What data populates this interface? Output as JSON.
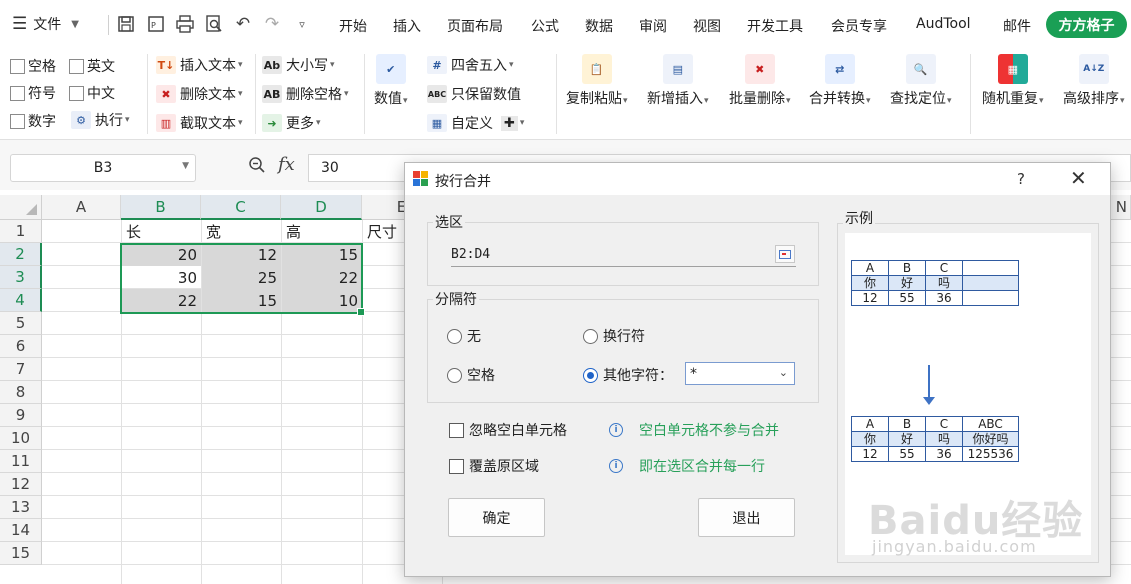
{
  "menubar": {
    "file_label": "文件",
    "tabs": [
      "开始",
      "插入",
      "页面布局",
      "公式",
      "数据",
      "审阅",
      "视图",
      "开发工具",
      "会员专享",
      "AudTool",
      "邮件"
    ],
    "active_tab": "方方格子"
  },
  "ribbon": {
    "checkboxes": [
      "空格",
      "英文",
      "符号",
      "中文",
      "数字"
    ],
    "execute": "执行",
    "text_tools": [
      "插入文本",
      "删除文本",
      "截取文本"
    ],
    "case_tools": [
      "大小写",
      "删除空格",
      "更多"
    ],
    "number": "数值",
    "number_tools": [
      "四舍五入",
      "只保留数值",
      "自定义"
    ],
    "big_buttons": [
      "复制粘贴",
      "新增插入",
      "批量删除",
      "合并转换",
      "查找定位",
      "随机重复",
      "高级排序"
    ]
  },
  "formula": {
    "name_box": "B3",
    "fx": "fx",
    "content": "30"
  },
  "sheet": {
    "columns": [
      "A",
      "B",
      "C",
      "D",
      "E",
      "N"
    ],
    "rows": [
      "1",
      "2",
      "3",
      "4",
      "5",
      "6",
      "7",
      "8",
      "9",
      "10",
      "11",
      "12",
      "13",
      "14",
      "15"
    ],
    "headers": [
      "长",
      "宽",
      "高",
      "尺寸"
    ],
    "data": [
      [
        "20",
        "12",
        "15"
      ],
      [
        "30",
        "25",
        "22"
      ],
      [
        "22",
        "15",
        "10"
      ]
    ]
  },
  "dialog": {
    "title": "按行合并",
    "help": "?",
    "close": "✕",
    "range_label": "选区",
    "range_value": "B2:D4",
    "sep_label": "分隔符",
    "opt_none": "无",
    "opt_newline": "换行符",
    "opt_space": "空格",
    "opt_other": "其他字符：",
    "other_value": "*",
    "ignore_blank": "忽略空白单元格",
    "ignore_blank_hint": "空白单元格不参与合并",
    "overwrite": "覆盖原区域",
    "overwrite_hint": "即在选区合并每一行",
    "ok": "确定",
    "exit": "退出",
    "example_label": "示例",
    "example_before": [
      [
        "A",
        "B",
        "C",
        ""
      ],
      [
        "你",
        "好",
        "吗",
        ""
      ],
      [
        "12",
        "55",
        "36",
        ""
      ]
    ],
    "example_after": [
      [
        "A",
        "B",
        "C",
        "ABC"
      ],
      [
        "你",
        "好",
        "吗",
        "你好吗"
      ],
      [
        "12",
        "55",
        "36",
        "125536"
      ]
    ]
  },
  "watermark": {
    "text": "Baidu经验",
    "url": "jingyan.baidu.com"
  }
}
